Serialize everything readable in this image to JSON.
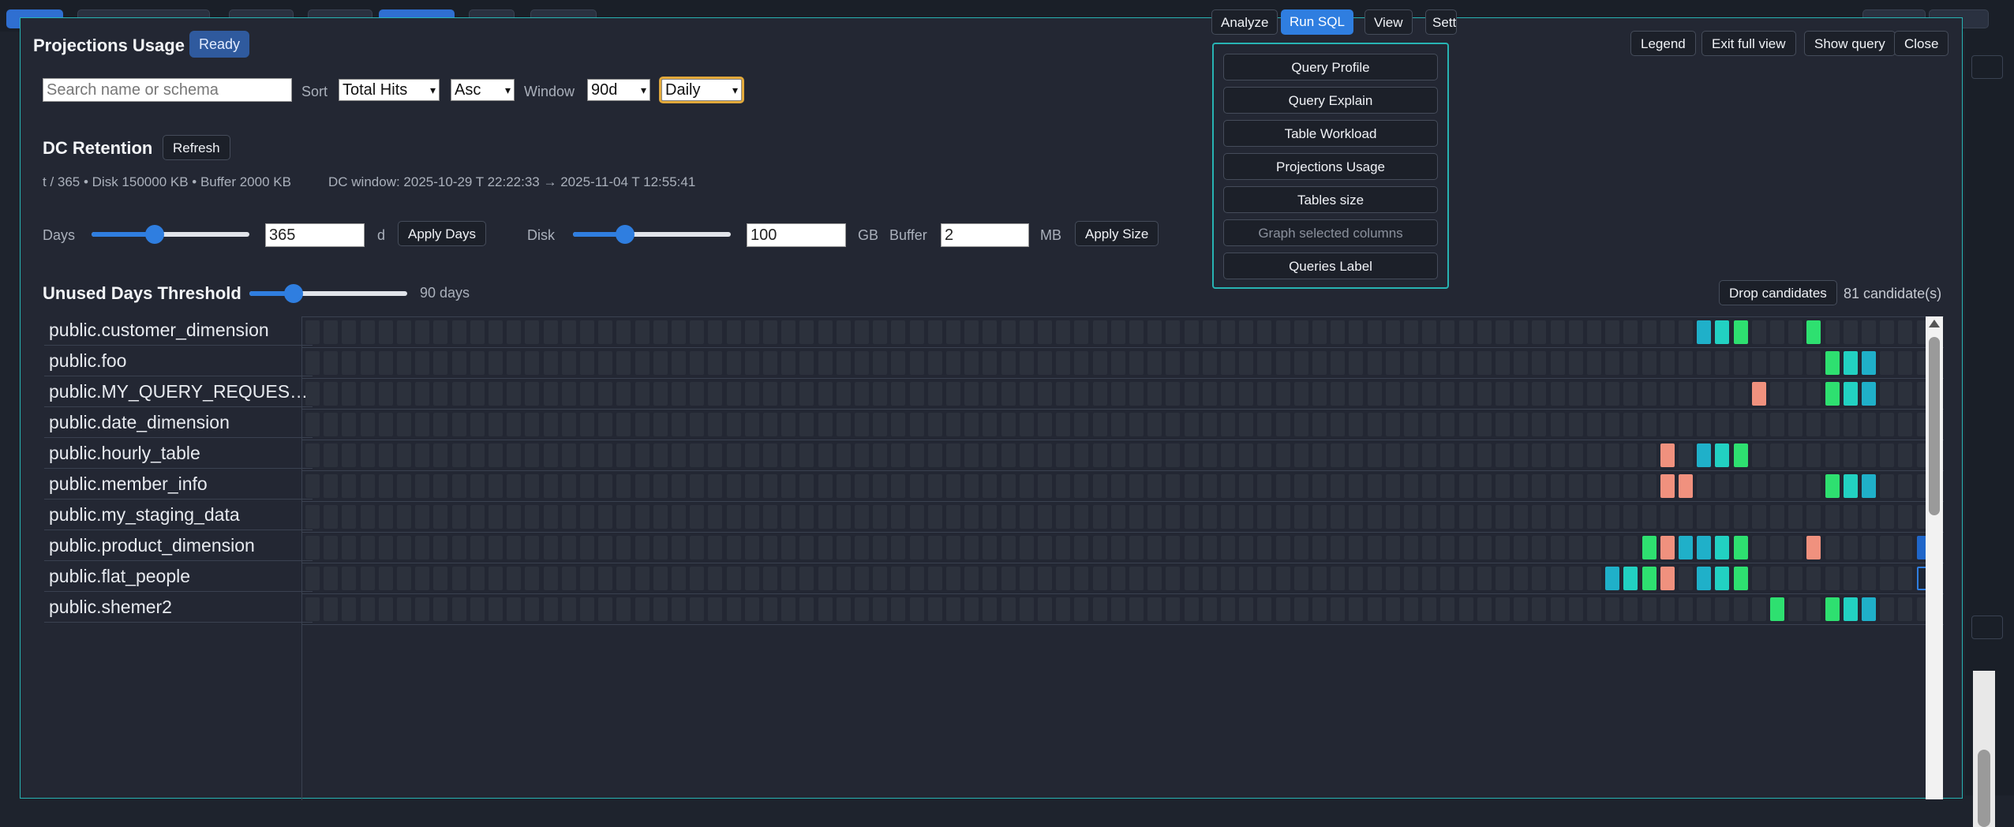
{
  "modal": {
    "title": "Projections Usage",
    "status": "Ready",
    "buttons": {
      "legend": "Legend",
      "exit_full_view": "Exit full view",
      "show_query": "Show query",
      "close": "Close"
    }
  },
  "filters": {
    "search_placeholder": "Search name or schema",
    "sort_label": "Sort",
    "sort_value": "Total Hits",
    "order_value": "Asc",
    "window_label": "Window",
    "window_value": "90d",
    "granularity_value": "Daily"
  },
  "retention": {
    "heading": "DC Retention",
    "refresh": "Refresh",
    "info": "t / 365 • Disk 150000 KB • Buffer 2000 KB",
    "dc_window": "DC window: 2025-10-29 T 22:22:33 → 2025-11-04 T 12:55:41",
    "days_label": "Days",
    "days_value": "365",
    "days_unit": "d",
    "days_slider_level": 0.4,
    "apply_days": "Apply Days",
    "disk_label": "Disk",
    "disk_value": "100",
    "disk_unit": "GB",
    "disk_slider_level": 0.33,
    "buffer_label": "Buffer",
    "buffer_value": "2",
    "buffer_unit": "MB",
    "apply_size": "Apply Size"
  },
  "unused": {
    "heading": "Unused Days Threshold",
    "slider_level": 0.28,
    "value_text": "90 days",
    "drop_candidates": "Drop candidates",
    "candidate_count": "81 candidate(s)"
  },
  "projections": [
    {
      "name": "public.customer_dimension",
      "hits": {
        "76": "teal",
        "77": "cyan",
        "78": "green",
        "82": "green"
      }
    },
    {
      "name": "public.foo",
      "hits": {
        "83": "green",
        "84": "cyan",
        "85": "teal"
      }
    },
    {
      "name": "public.MY_QUERY_REQUESTS...",
      "hits": {
        "79": "salmon",
        "83": "green",
        "84": "cyan",
        "85": "teal"
      }
    },
    {
      "name": "public.date_dimension",
      "hits": {}
    },
    {
      "name": "public.hourly_table",
      "hits": {
        "74": "salmon",
        "76": "teal",
        "77": "cyan",
        "78": "green"
      }
    },
    {
      "name": "public.member_info",
      "hits": {
        "74": "salmon",
        "75": "salmon",
        "83": "green",
        "84": "cyan",
        "85": "teal"
      }
    },
    {
      "name": "public.my_staging_data",
      "hits": {}
    },
    {
      "name": "public.product_dimension",
      "hits": {
        "73": "green",
        "74": "salmon",
        "75": "teal",
        "76": "teal",
        "77": "cyan",
        "78": "green",
        "82": "salmon",
        "88": "blue"
      }
    },
    {
      "name": "public.flat_people",
      "hits": {
        "71": "teal",
        "72": "cyan",
        "73": "green",
        "74": "salmon",
        "76": "teal",
        "77": "cyan",
        "78": "green",
        "88": "outline"
      }
    },
    {
      "name": "public.shemer2",
      "hits": {
        "80": "green",
        "83": "green",
        "84": "cyan",
        "85": "teal"
      }
    }
  ],
  "top_menu": {
    "analyze": "Analyze",
    "run_sql": "Run SQL",
    "view": "View",
    "settings": "Sett",
    "items": [
      "Query Profile",
      "Query Explain",
      "Table Workload",
      "Projections Usage",
      "Tables size",
      "Graph selected columns",
      "Queries Label"
    ]
  },
  "colors": {
    "accent": "#2f7ee0",
    "border": "#27b3b3",
    "teal": "#1fb0c9",
    "cyan": "#22d1c2",
    "green": "#2ee070",
    "salmon": "#f0917e",
    "blue": "#1f66c9"
  }
}
